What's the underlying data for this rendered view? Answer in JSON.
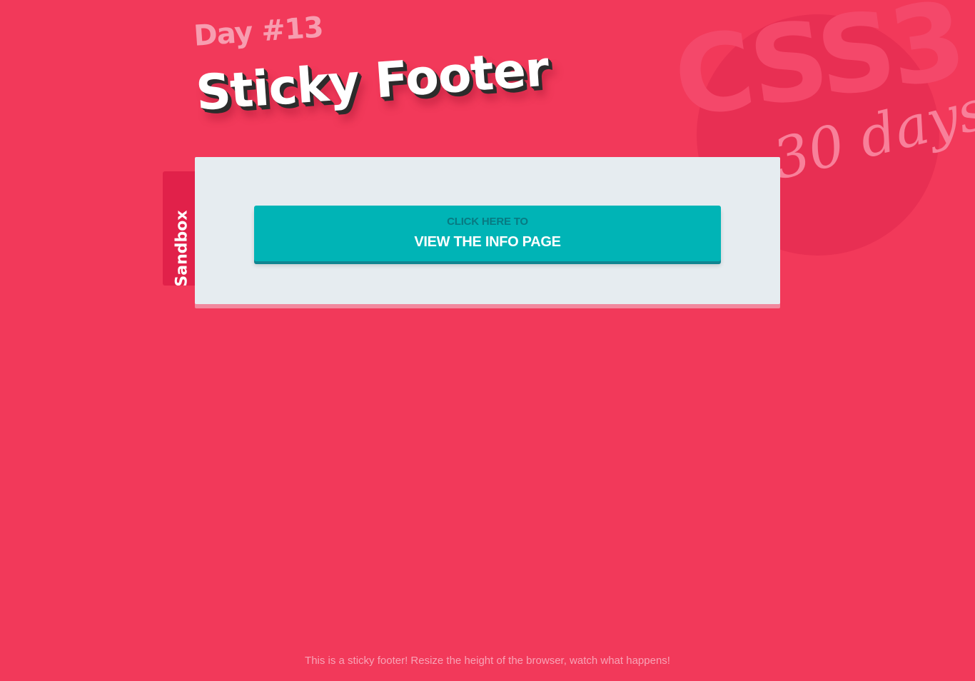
{
  "background_badge": {
    "logo_text": "CSS3",
    "tagline": "30 days"
  },
  "header": {
    "day_label": "Day #13",
    "title": "Sticky Footer"
  },
  "side_tab": {
    "label": "Sandbox"
  },
  "card": {
    "button": {
      "small_label": "CLICK HERE TO",
      "main_label": "VIEW THE INFO PAGE"
    }
  },
  "footer": {
    "text": "This is a sticky footer! Resize the height of the browser, watch what happens!"
  },
  "colors": {
    "background": "#f2395a",
    "card": "#e6ecf0",
    "button": "#00b4b6",
    "side_tab": "#e1214a"
  }
}
